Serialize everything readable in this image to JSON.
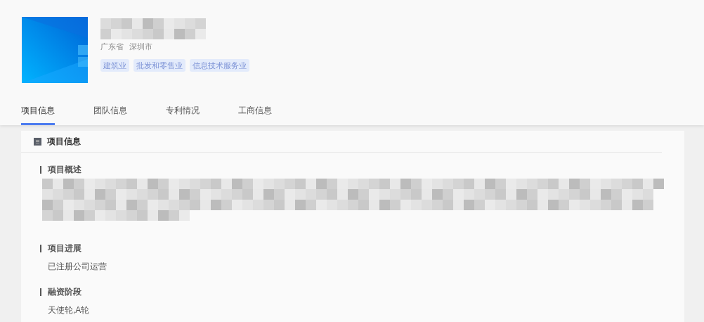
{
  "company": {
    "logo": {
      "kind": "picture"
    },
    "name": {
      "kind": "redacted"
    },
    "location": [
      "广东省",
      "深圳市"
    ],
    "tags": [
      "建筑业",
      "批发和零售业",
      "信息技术服务业"
    ]
  },
  "tabs": [
    {
      "label": "项目信息",
      "selected": true
    },
    {
      "label": "团队信息",
      "selected": false
    },
    {
      "label": "专利情况",
      "selected": false
    },
    {
      "label": "工商信息",
      "selected": false
    }
  ],
  "panel": {
    "title": "项目信息",
    "sections": [
      {
        "label": "项目概述",
        "kind": "redacted"
      },
      {
        "label": "项目进展",
        "kind": "text",
        "value": "已注册公司运营"
      },
      {
        "label": "融资阶段",
        "kind": "text",
        "value": "天使轮,A轮"
      }
    ]
  }
}
